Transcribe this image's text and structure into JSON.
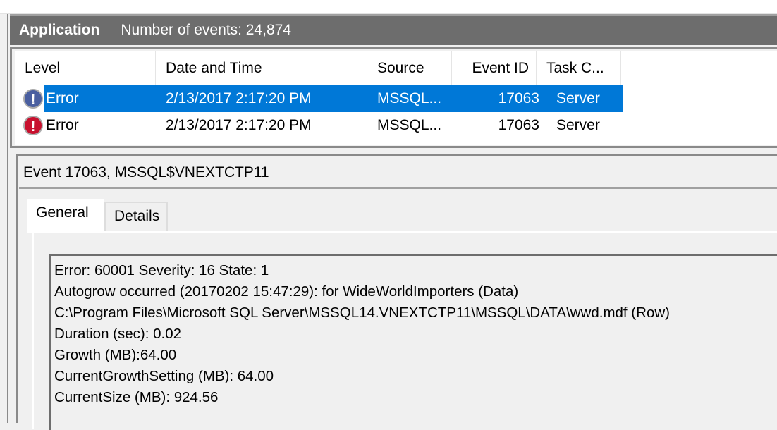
{
  "header": {
    "log_name": "Application",
    "event_count": "Number of events: 24,874"
  },
  "columns": [
    "Level",
    "Date and Time",
    "Source",
    "Event ID",
    "Task C..."
  ],
  "events": [
    {
      "level": "Error",
      "datetime": "2/13/2017 2:17:20 PM",
      "source": "MSSQL...",
      "event_id": "17063",
      "task": "Server",
      "selected": true
    },
    {
      "level": "Error",
      "datetime": "2/13/2017 2:17:20 PM",
      "source": "MSSQL...",
      "event_id": "17063",
      "task": "Server",
      "selected": false
    }
  ],
  "detail": {
    "title": "Event 17063, MSSQL$VNEXTCTP11",
    "tabs": [
      "General",
      "Details"
    ],
    "lines": [
      "Error: 60001 Severity: 16 State: 1",
      "Autogrow occurred (20170202 15:47:29): for WideWorldImporters (Data)",
      "C:\\Program Files\\Microsoft SQL Server\\MSSQL14.VNEXTCTP11\\MSSQL\\DATA\\wwd.mdf (Row)",
      "Duration (sec): 0.02",
      "Growth (MB):64.00",
      "CurrentGrowthSetting (MB): 64.00",
      "CurrentSize (MB): 924.56"
    ]
  },
  "colors": {
    "header_bg": "#6d6d6d",
    "selection": "#0078d7",
    "error_icon": "#c8102e"
  }
}
